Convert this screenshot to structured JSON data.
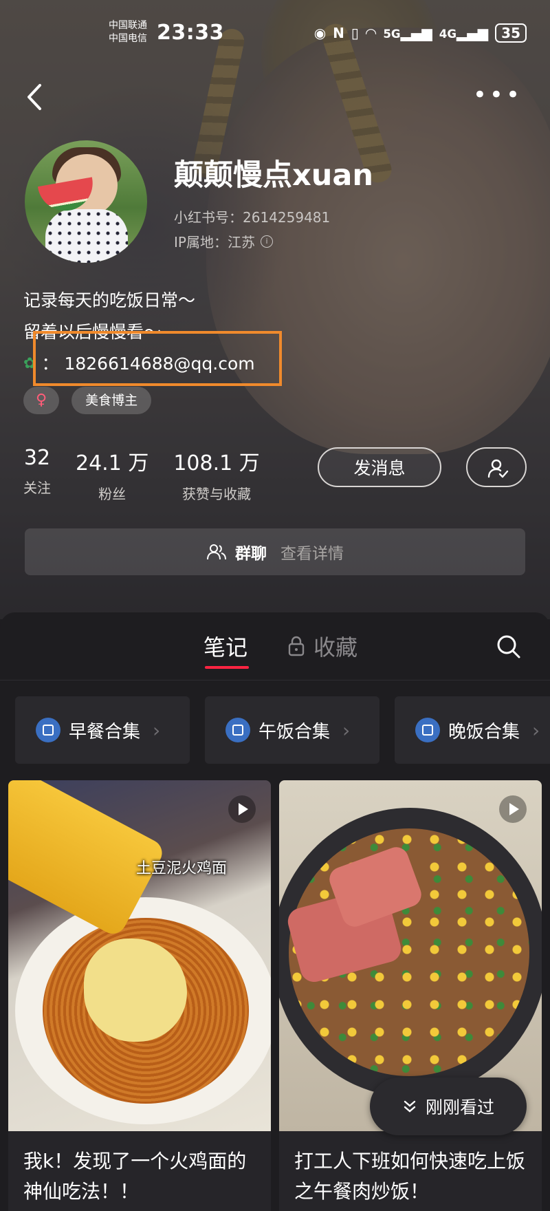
{
  "status_bar": {
    "carrier_1": "中国联通",
    "carrier_2": "中国电信",
    "time": "23:33",
    "network_5g": "5G",
    "network_4g": "4G",
    "battery": "35"
  },
  "profile": {
    "name": "颠颠慢点xuan",
    "red_id": "小红书号：2614259481",
    "ip_location": "IP属地：江苏",
    "bio_line_1": "记录每天的吃饭日常～",
    "bio_line_2": "留着以后慢慢看～",
    "contact_prefix": "：",
    "contact_email": "1826614688@qq.com",
    "tags": {
      "gender": "♀",
      "category": "美食博主"
    },
    "stats": {
      "following_num": "32",
      "following_label": "关注",
      "fans_num": "24.1 万",
      "fans_label": "粉丝",
      "likes_num": "108.1 万",
      "likes_label": "获赞与收藏"
    },
    "message_button": "发消息",
    "group_chat_label": "群聊",
    "group_chat_detail": "查看详情"
  },
  "tabs": {
    "notes": "笔记",
    "favorites": "收藏"
  },
  "collections": [
    {
      "label": "早餐合集"
    },
    {
      "label": "午饭合集"
    },
    {
      "label": "晚饭合集"
    }
  ],
  "cards": [
    {
      "image_caption": "土豆泥火鸡面",
      "title": "我k！发现了一个火鸡面的神仙吃法！！"
    },
    {
      "title": "打工人下班如何快速吃上饭之午餐肉炒饭！"
    }
  ],
  "recently_viewed": "刚刚看过",
  "colors": {
    "accent": "#ff2442",
    "highlight_box": "#f08a2c",
    "collection_icon": "#3a6fc2"
  }
}
